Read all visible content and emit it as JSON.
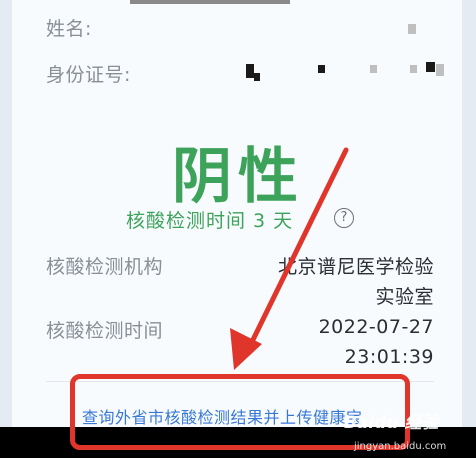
{
  "personal": {
    "name_label": "姓名:",
    "id_label": "身份证号:"
  },
  "result": {
    "status": "阴性",
    "detection_period": "核酸检测时间 3 天",
    "help_icon": "?"
  },
  "details": {
    "institution_label": "核酸检测机构",
    "institution_value_line1": "北京谱尼医学检验",
    "institution_value_line2": "实验室",
    "time_label": "核酸检测时间",
    "time_date": "2022-07-27",
    "time_clock": "23:01:39"
  },
  "action": {
    "upload_link": "查询外省市核酸检测结果并上传健康宝"
  },
  "watermark": {
    "brand": "Baidu 经验",
    "url": "jingyan.baidu.com"
  },
  "colors": {
    "result_green": "#3ea35a",
    "link_blue": "#3a78d8",
    "annotation_red": "#e0352b"
  }
}
